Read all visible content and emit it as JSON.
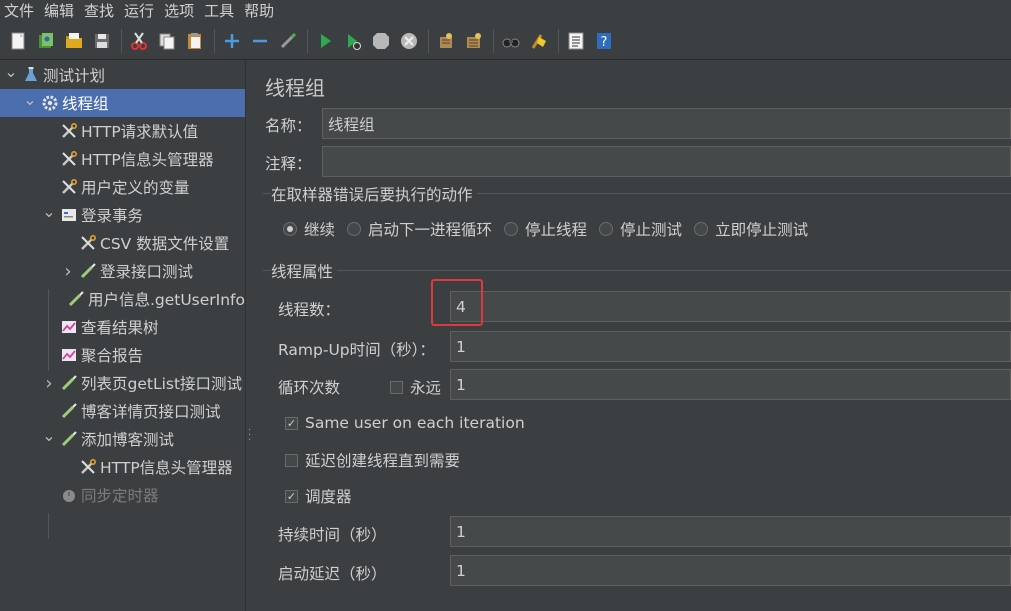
{
  "menu": [
    "文件",
    "编辑",
    "查找",
    "运行",
    "选项",
    "工具",
    "帮助"
  ],
  "toolbar": {
    "icons": [
      "new-icon",
      "templates-icon",
      "open-icon",
      "save-icon",
      "cut-icon",
      "copy-icon",
      "paste-icon",
      "expand-icon",
      "collapse-icon",
      "toggle-icon",
      "start-icon",
      "start-no-pause-icon",
      "stop-icon",
      "shutdown-icon",
      "clear-icon",
      "clear-all-icon",
      "search-icon",
      "reset-search-icon",
      "function-helper-icon",
      "help-icon"
    ]
  },
  "tree": {
    "items": [
      {
        "label": "测试计划",
        "arrow": "expanded",
        "icon": "test-plan-icon"
      },
      {
        "label": "线程组",
        "arrow": "expanded",
        "icon": "thread-group-icon",
        "selected": true
      },
      {
        "label": "HTTP请求默认值",
        "arrow": "",
        "icon": "config-element-icon"
      },
      {
        "label": "HTTP信息头管理器",
        "arrow": "",
        "icon": "config-element-icon"
      },
      {
        "label": "用户定义的变量",
        "arrow": "",
        "icon": "config-element-icon"
      },
      {
        "label": "登录事务",
        "arrow": "expanded",
        "icon": "transaction-controller-icon"
      },
      {
        "label": "CSV 数据文件设置",
        "arrow": "",
        "icon": "config-element-icon"
      },
      {
        "label": "登录接口测试",
        "arrow": "collapsed",
        "icon": "sampler-icon"
      },
      {
        "label": "用户信息.getUserInfo",
        "arrow": "",
        "icon": "sampler-icon"
      },
      {
        "label": "查看结果树",
        "arrow": "",
        "icon": "listener-icon"
      },
      {
        "label": "聚合报告",
        "arrow": "",
        "icon": "listener-icon"
      },
      {
        "label": "列表页getList接口测试",
        "arrow": "collapsed",
        "icon": "sampler-icon"
      },
      {
        "label": "博客详情页接口测试",
        "arrow": "",
        "icon": "sampler-icon"
      },
      {
        "label": "添加博客测试",
        "arrow": "expanded",
        "icon": "sampler-icon"
      },
      {
        "label": "HTTP信息头管理器",
        "arrow": "",
        "icon": "config-element-icon"
      },
      {
        "label": "同步定时器",
        "arrow": "",
        "icon": "timer-icon",
        "disabled": true
      }
    ]
  },
  "panel": {
    "title": "线程组",
    "name_label": "名称：",
    "name_value": "线程组",
    "comment_label": "注释：",
    "comment_value": "",
    "error_action": {
      "title": "在取样器错误后要执行的动作",
      "options": [
        "继续",
        "启动下一进程循环",
        "停止线程",
        "停止测试",
        "立即停止测试"
      ],
      "selected": "继续"
    },
    "thread_props": {
      "title": "线程属性",
      "threads_label": "线程数：",
      "threads_value": "4",
      "rampup_label": "Ramp-Up时间（秒）：",
      "rampup_value": "1",
      "loop_label": "循环次数",
      "forever_label": "永远",
      "forever_checked": false,
      "loop_value": "1",
      "same_user_label": "Same user on each iteration",
      "same_user_checked": true,
      "delay_label": "延迟创建线程直到需要",
      "delay_checked": false,
      "scheduler_label": "调度器",
      "scheduler_checked": true,
      "duration_label": "持续时间（秒）",
      "duration_value": "1",
      "startup_delay_label": "启动延迟（秒）",
      "startup_delay_value": "1"
    }
  },
  "colors": {
    "background": "#3c3f41",
    "selection": "#4b6eaf",
    "input_bg": "#45494a",
    "highlight_box": "#e0383b"
  }
}
